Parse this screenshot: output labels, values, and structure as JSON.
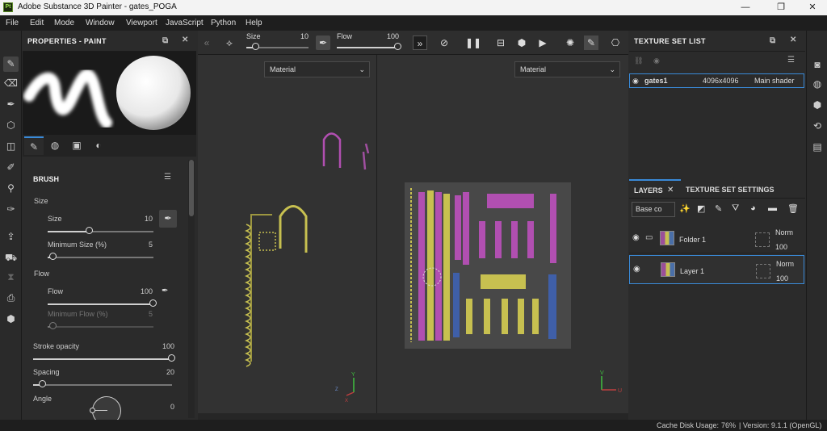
{
  "window": {
    "title": "Adobe Substance 3D Painter - gates_POGA",
    "logo": "Pt",
    "minimize": "—",
    "maximize": "❐",
    "close": "✕"
  },
  "menu": [
    "File",
    "Edit",
    "Mode",
    "Window",
    "Viewport",
    "JavaScript",
    "Python",
    "Help"
  ],
  "properties": {
    "title": "PROPERTIES - PAINT",
    "section": "BRUSH",
    "size_group": "Size",
    "size_label": "Size",
    "size_value": "10",
    "size_fraction": 0.4,
    "min_size_label": "Minimum Size (%)",
    "min_size_value": "5",
    "min_size_fraction": 0.05,
    "flow_group": "Flow",
    "flow_label": "Flow",
    "flow_value": "100",
    "flow_fraction": 1.0,
    "min_flow_label": "Minimum Flow (%)",
    "min_flow_value": "5",
    "min_flow_fraction": 0.05,
    "stroke_opacity_label": "Stroke opacity",
    "stroke_opacity_value": "100",
    "stroke_opacity_fraction": 1.0,
    "spacing_label": "Spacing",
    "spacing_value": "20",
    "spacing_fraction": 0.07,
    "angle_label": "Angle",
    "angle_value": "0"
  },
  "toolbar": {
    "size_label": "Size",
    "size_value": "10",
    "size_fraction": 0.15,
    "flow_label": "Flow",
    "flow_value": "100",
    "flow_fraction": 1.0
  },
  "viewport": {
    "left_dropdown": "Material",
    "right_dropdown": "Material"
  },
  "texture_set_list": {
    "title": "TEXTURE SET LIST",
    "row": {
      "name": "gates1",
      "resolution": "4096x4096",
      "shader": "Main shader"
    }
  },
  "layers_panel": {
    "tab_layers": "LAYERS",
    "tab_settings": "TEXTURE SET SETTINGS",
    "channel_dropdown": "Base co",
    "layers": [
      {
        "name": "Folder 1",
        "blend": "Norm",
        "opacity": "100"
      },
      {
        "name": "Layer 1",
        "blend": "Norm",
        "opacity": "100"
      }
    ]
  },
  "status": {
    "cache_label": "Cache Disk Usage:",
    "cache_value": "76%",
    "version": "| Version: 9.1.1 (OpenGL)"
  },
  "colors": {
    "accent": "#3a8ad8",
    "purple": "#b14fb1",
    "yellow": "#c7c050",
    "blue": "#3f5fa8"
  }
}
